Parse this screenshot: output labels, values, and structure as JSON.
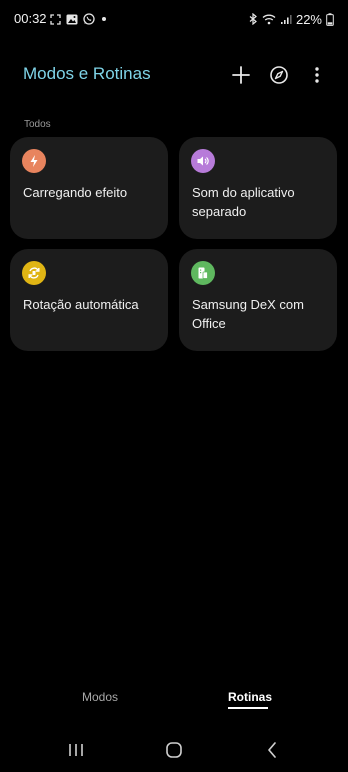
{
  "status_bar": {
    "time": "00:32",
    "battery_text": "22%",
    "left_icons": [
      "focus-frame-icon",
      "gallery-icon",
      "whatsapp-icon",
      "dot-icon"
    ],
    "right_icons": [
      "bluetooth-icon",
      "wifi-icon",
      "signal-icon",
      "battery-icon"
    ]
  },
  "header": {
    "title": "Modos e Rotinas",
    "actions": [
      "add-icon",
      "discover-compass-icon",
      "more-options-icon"
    ]
  },
  "section": {
    "label": "Todos"
  },
  "routines": [
    {
      "label": "Carregando efeito",
      "icon": "lightning-icon",
      "color": "#e8845e"
    },
    {
      "label": "Som do aplicativo separado",
      "icon": "volume-icon",
      "color": "#b77bd9"
    },
    {
      "label": "Rotação automática",
      "icon": "auto-rotate-icon",
      "color": "#e0b514"
    },
    {
      "label": "Samsung DeX com Office",
      "icon": "dex-office-icon",
      "color": "#5fb85f"
    }
  ],
  "tabs": {
    "modos": "Modos",
    "rotinas": "Rotinas",
    "selected": "Rotinas"
  },
  "nav": [
    "recent-apps-icon",
    "home-icon",
    "back-icon"
  ]
}
